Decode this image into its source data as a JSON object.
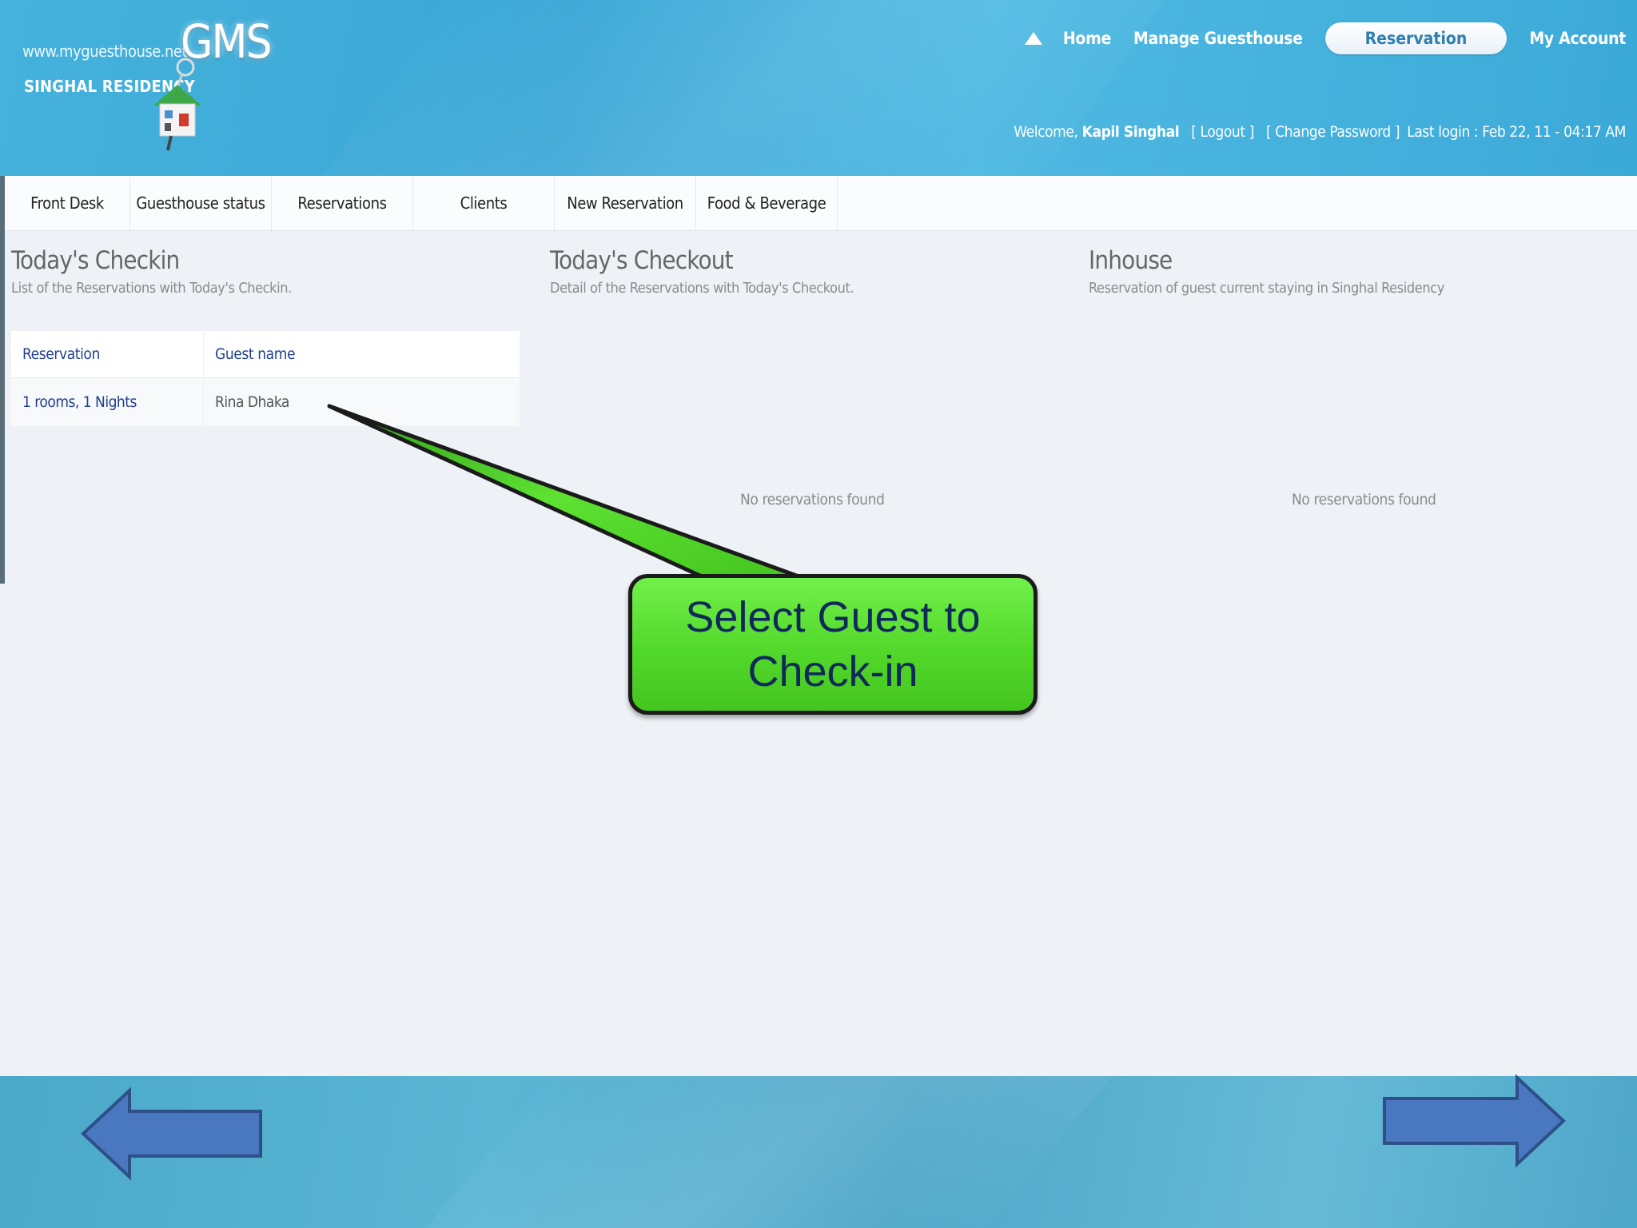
{
  "brand": {
    "url": "www.myguesthouse.net",
    "logo": "GMS",
    "property": "SINGHAL RESIDENCY"
  },
  "topnav": {
    "home": "Home",
    "manage": "Manage Guesthouse",
    "reservation": "Reservation",
    "account": "My Account"
  },
  "user": {
    "welcome": "Welcome,",
    "name": "Kapil Singhal",
    "logout": "[ Logout ]",
    "change_password": "[ Change Password ]",
    "last_login": "Last login : Feb 22, 11 - 04:17 AM"
  },
  "tabs": [
    "Front Desk",
    "Guesthouse status",
    "Reservations",
    "Clients",
    "New Reservation",
    "Food & Beverage"
  ],
  "checkin": {
    "title": "Today's Checkin",
    "desc": "List of the Reservations with Today's Checkin.",
    "columns": [
      "Reservation",
      "Guest name"
    ],
    "rows": [
      {
        "reservation": "1 rooms, 1 Nights",
        "guest": "Rina Dhaka"
      }
    ]
  },
  "checkout": {
    "title": "Today's Checkout",
    "desc": "Detail of the Reservations with Today's Checkout.",
    "empty": "No reservations found"
  },
  "inhouse": {
    "title": "Inhouse",
    "desc": "Reservation of guest current staying in Singhal Residency",
    "empty": "No reservations found"
  },
  "callout": {
    "text": "Select Guest to\nCheck-in",
    "fill": "#5ee336",
    "text_color": "#0f2a5a"
  },
  "nav_arrows": {
    "prev": "left-arrow-icon",
    "next": "right-arrow-icon",
    "color": "#4a78c0"
  }
}
